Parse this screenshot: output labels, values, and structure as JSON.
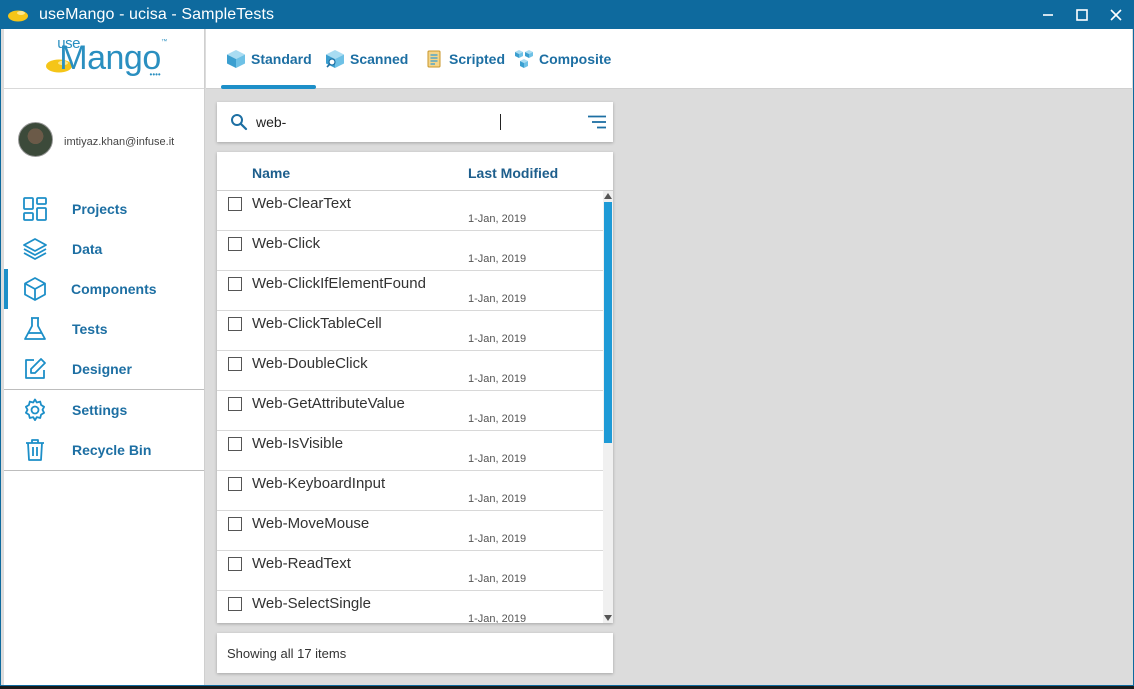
{
  "window": {
    "title": "useMango - ucisa - SampleTests",
    "controls": {
      "minimize": "minimize-icon",
      "maximize": "maximize-icon",
      "close": "close-icon"
    }
  },
  "logo": {
    "prefix": "use",
    "name": "Mango",
    "tm": "™",
    "dots": "••••"
  },
  "user": {
    "email": "imtiyaz.khan@infuse.it"
  },
  "sidebar": {
    "items": [
      {
        "label": "Projects",
        "icon": "dashboard-icon"
      },
      {
        "label": "Data",
        "icon": "layers-icon"
      },
      {
        "label": "Components",
        "icon": "cube-icon",
        "active": true
      },
      {
        "label": "Tests",
        "icon": "flask-icon"
      },
      {
        "label": "Designer",
        "icon": "edit-icon"
      }
    ],
    "items2": [
      {
        "label": "Settings",
        "icon": "gear-icon"
      },
      {
        "label": "Recycle Bin",
        "icon": "trash-icon"
      }
    ]
  },
  "tabs": [
    {
      "label": "Standard",
      "icon": "standard-cube-icon",
      "active": true
    },
    {
      "label": "Scanned",
      "icon": "scanned-cube-icon"
    },
    {
      "label": "Scripted",
      "icon": "scripted-icon"
    },
    {
      "label": "Composite",
      "icon": "composite-cube-icon"
    }
  ],
  "search": {
    "value": "web-"
  },
  "list": {
    "headers": {
      "name": "Name",
      "modified": "Last Modified"
    },
    "rows": [
      {
        "name": "Web-ClearText",
        "date": "1-Jan, 2019"
      },
      {
        "name": "Web-Click",
        "date": "1-Jan, 2019"
      },
      {
        "name": "Web-ClickIfElementFound",
        "date": "1-Jan, 2019"
      },
      {
        "name": "Web-ClickTableCell",
        "date": "1-Jan, 2019"
      },
      {
        "name": "Web-DoubleClick",
        "date": "1-Jan, 2019"
      },
      {
        "name": "Web-GetAttributeValue",
        "date": "1-Jan, 2019"
      },
      {
        "name": "Web-IsVisible",
        "date": "1-Jan, 2019"
      },
      {
        "name": "Web-KeyboardInput",
        "date": "1-Jan, 2019"
      },
      {
        "name": "Web-MoveMouse",
        "date": "1-Jan, 2019"
      },
      {
        "name": "Web-ReadText",
        "date": "1-Jan, 2019"
      },
      {
        "name": "Web-SelectSingle",
        "date": "1-Jan, 2019"
      }
    ]
  },
  "footer": {
    "text": "Showing all 17 items"
  },
  "colors": {
    "titlebar": "#0e6a9e",
    "accent": "#1d8fc8",
    "label": "#1d6fa3",
    "content_bg": "#dcdcdc"
  }
}
